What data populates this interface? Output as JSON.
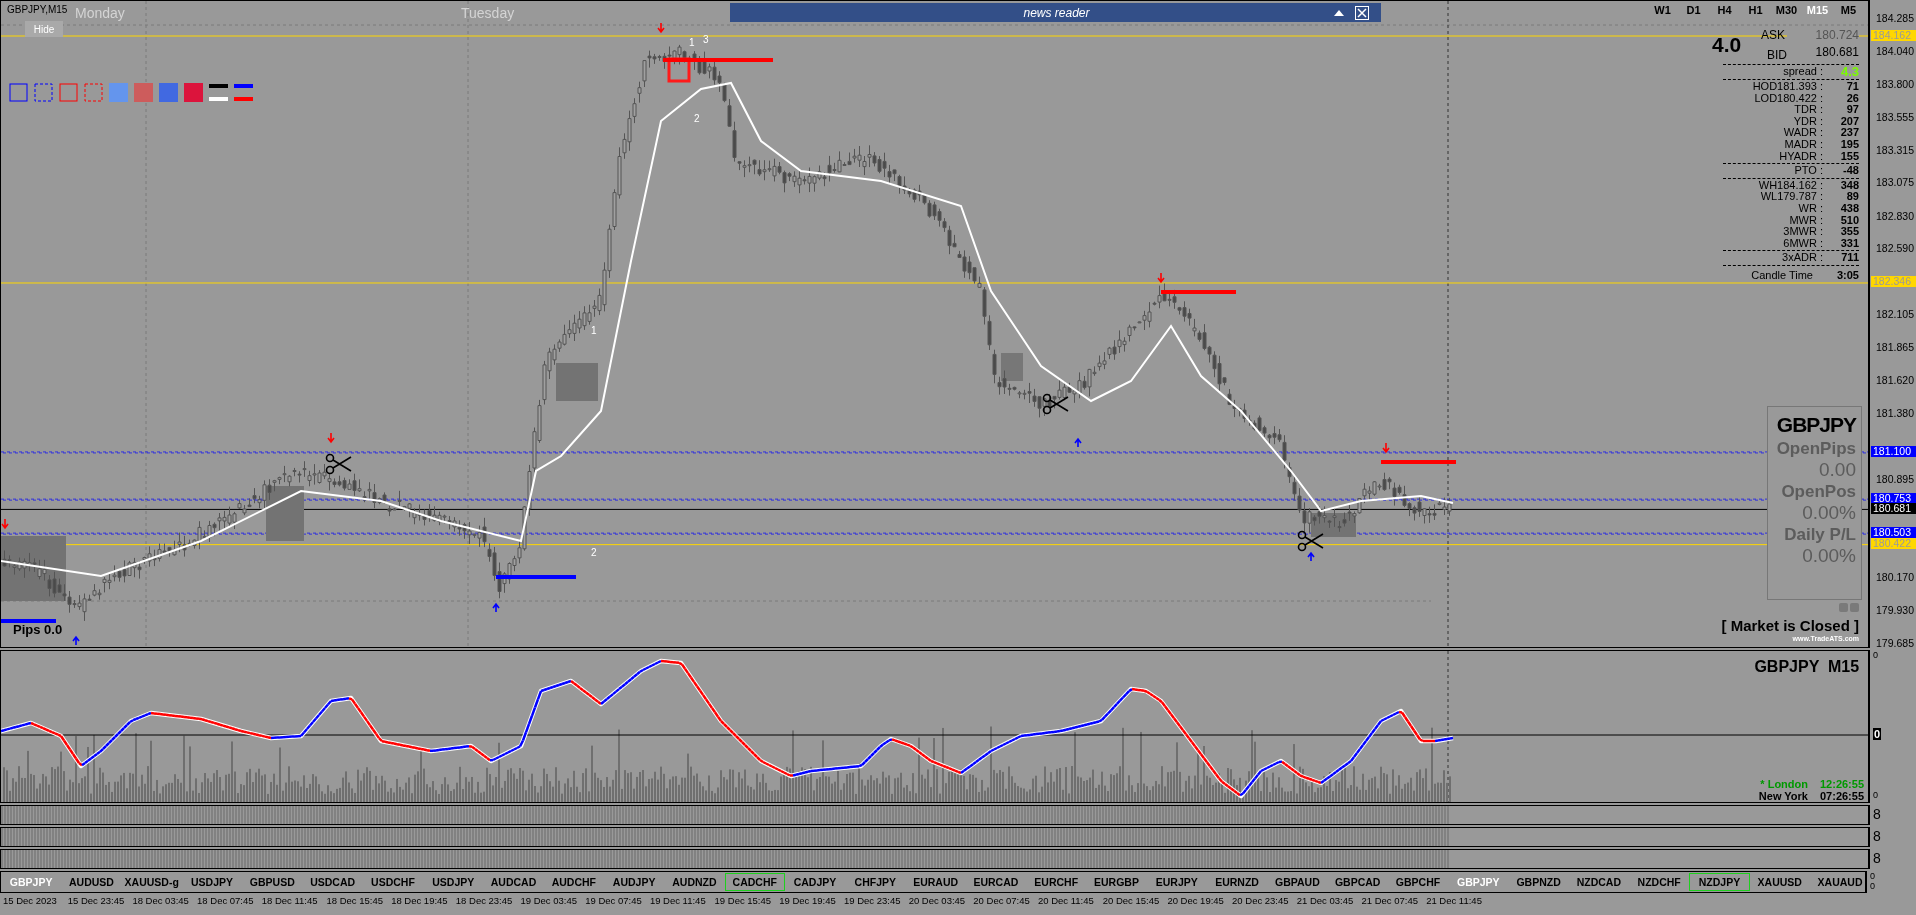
{
  "chart": {
    "title": "GBPJPY,M15",
    "hide_button": "Hide",
    "day_labels": [
      "Monday",
      "Tuesday"
    ],
    "news_reader": {
      "title": "news reader"
    },
    "wave_labels": [
      "1",
      "3",
      "2",
      "1",
      "2"
    ],
    "pips": "Pips 0.0"
  },
  "timeframes": [
    {
      "label": "W1",
      "selected": false
    },
    {
      "label": "D1",
      "selected": false
    },
    {
      "label": "H4",
      "selected": false
    },
    {
      "label": "H1",
      "selected": false
    },
    {
      "label": "M30",
      "selected": false
    },
    {
      "label": "M15",
      "selected": true
    },
    {
      "label": "M5",
      "selected": false
    }
  ],
  "quote": {
    "spread": "4.0",
    "ask_label": "ASK",
    "ask": "180.724",
    "bid_label": "BID",
    "bid": "180.681"
  },
  "stats": {
    "groups": [
      {
        "rows": [
          {
            "label": "spread :",
            "value": "4.3",
            "color": "#7cfc00"
          }
        ]
      },
      {
        "rows": [
          {
            "label": "HOD181.393 :",
            "value": "71"
          },
          {
            "label": "LOD180.422 :",
            "value": "26"
          },
          {
            "label": "TDR :",
            "value": "97"
          },
          {
            "label": "YDR :",
            "value": "207"
          },
          {
            "label": "WADR :",
            "value": "237"
          },
          {
            "label": "MADR :",
            "value": "195"
          },
          {
            "label": "HYADR :",
            "value": "155"
          }
        ]
      },
      {
        "rows": [
          {
            "label": "PTO :",
            "value": "-48"
          }
        ]
      },
      {
        "rows": [
          {
            "label": "WH184.162 :",
            "value": "348"
          },
          {
            "label": "WL179.787 :",
            "value": "89"
          },
          {
            "label": "WR :",
            "value": "438"
          },
          {
            "label": "MWR :",
            "value": "510"
          },
          {
            "label": "3MWR :",
            "value": "355"
          },
          {
            "label": "6MWR :",
            "value": "331"
          }
        ]
      },
      {
        "rows": [
          {
            "label": "3xADR :",
            "value": "711"
          }
        ]
      }
    ],
    "candle_time": {
      "label": "Candle Time",
      "value": "3:05"
    }
  },
  "price_axis": [
    {
      "label": "184.285",
      "kind": "tick"
    },
    {
      "label": "184.162",
      "kind": "level",
      "color": "#ffd700",
      "dashed": false
    },
    {
      "label": "184.040",
      "kind": "tick"
    },
    {
      "label": "183.800",
      "kind": "tick"
    },
    {
      "label": "183.555",
      "kind": "tick"
    },
    {
      "label": "183.315",
      "kind": "tick"
    },
    {
      "label": "183.075",
      "kind": "tick"
    },
    {
      "label": "182.830",
      "kind": "tick"
    },
    {
      "label": "182.590",
      "kind": "tick"
    },
    {
      "label": "182.346",
      "kind": "level",
      "color": "#ffd700",
      "dashed": false
    },
    {
      "label": "182.105",
      "kind": "tick"
    },
    {
      "label": "181.865",
      "kind": "tick"
    },
    {
      "label": "181.620",
      "kind": "tick"
    },
    {
      "label": "181.380",
      "kind": "tick"
    },
    {
      "label": "181.100",
      "kind": "level",
      "color": "#0000ff",
      "dashed": true
    },
    {
      "label": "180.895",
      "kind": "tick"
    },
    {
      "label": "180.753",
      "kind": "level",
      "color": "#0000ff",
      "dashed": true
    },
    {
      "label": "180.681",
      "kind": "level",
      "color": "#000000",
      "dashed": false
    },
    {
      "label": "180.503",
      "kind": "level",
      "color": "#0000ff",
      "dashed": true
    },
    {
      "label": "180.422",
      "kind": "level",
      "color": "#ffd700",
      "dashed": false
    },
    {
      "label": "180.170",
      "kind": "tick"
    },
    {
      "label": "179.930",
      "kind": "tick"
    },
    {
      "label": "179.685",
      "kind": "tick"
    }
  ],
  "account_panel": {
    "symbol": "GBPJPY",
    "fields": [
      {
        "label": "OpenPips",
        "value": "0.00"
      },
      {
        "label": "OpenPos",
        "value": "0.00%"
      },
      {
        "label": "Daily P/L",
        "value": "0.00%"
      }
    ]
  },
  "market_status": "[ Market is Closed ]",
  "website": "www.TradeATS.com",
  "indicator": {
    "title": "GBPJPY  M15",
    "sessions": [
      {
        "name": "* London",
        "time": "12:26:55",
        "color": "#009900"
      },
      {
        "name": "New York",
        "time": "07:26:55",
        "color": "#000000"
      }
    ],
    "axis": [
      "0",
      "0",
      "0"
    ]
  },
  "sub_panes": [
    {
      "axis": "8"
    },
    {
      "axis": "8"
    },
    {
      "axis": "8"
    }
  ],
  "symbols": [
    {
      "label": "GBPJPY",
      "selected": true,
      "outlined": false
    },
    {
      "label": "AUDUSD",
      "selected": false,
      "outlined": false
    },
    {
      "label": "XAUUSD-g",
      "selected": false,
      "outlined": false
    },
    {
      "label": "USDJPY",
      "selected": false,
      "outlined": false
    },
    {
      "label": "GBPUSD",
      "selected": false,
      "outlined": false
    },
    {
      "label": "USDCAD",
      "selected": false,
      "outlined": false
    },
    {
      "label": "USDCHF",
      "selected": false,
      "outlined": false
    },
    {
      "label": "USDJPY",
      "selected": false,
      "outlined": false
    },
    {
      "label": "AUDCAD",
      "selected": false,
      "outlined": false
    },
    {
      "label": "AUDCHF",
      "selected": false,
      "outlined": false
    },
    {
      "label": "AUDJPY",
      "selected": false,
      "outlined": false
    },
    {
      "label": "AUDNZD",
      "selected": false,
      "outlined": false
    },
    {
      "label": "CADCHF",
      "selected": false,
      "outlined": true
    },
    {
      "label": "CADJPY",
      "selected": false,
      "outlined": false
    },
    {
      "label": "CHFJPY",
      "selected": false,
      "outlined": false
    },
    {
      "label": "EURAUD",
      "selected": false,
      "outlined": false
    },
    {
      "label": "EURCAD",
      "selected": false,
      "outlined": false
    },
    {
      "label": "EURCHF",
      "selected": false,
      "outlined": false
    },
    {
      "label": "EURGBP",
      "selected": false,
      "outlined": false
    },
    {
      "label": "EURJPY",
      "selected": false,
      "outlined": false
    },
    {
      "label": "EURNZD",
      "selected": false,
      "outlined": false
    },
    {
      "label": "GBPAUD",
      "selected": false,
      "outlined": false
    },
    {
      "label": "GBPCAD",
      "selected": false,
      "outlined": false
    },
    {
      "label": "GBPCHF",
      "selected": false,
      "outlined": false
    },
    {
      "label": "GBPJPY",
      "selected": true,
      "outlined": false
    },
    {
      "label": "GBPNZD",
      "selected": false,
      "outlined": false
    },
    {
      "label": "NZDCAD",
      "selected": false,
      "outlined": false
    },
    {
      "label": "NZDCHF",
      "selected": false,
      "outlined": false
    },
    {
      "label": "NZDJPY",
      "selected": false,
      "outlined": true
    },
    {
      "label": "XAUUSD",
      "selected": false,
      "outlined": false
    },
    {
      "label": "XAUAUD",
      "selected": false,
      "outlined": false
    }
  ],
  "symbols_axis": [
    "0",
    "0"
  ],
  "time_axis": [
    "15 Dec 2023",
    "15 Dec 23:45",
    "18 Dec 03:45",
    "18 Dec 07:45",
    "18 Dec 11:45",
    "18 Dec 15:45",
    "18 Dec 19:45",
    "18 Dec 23:45",
    "19 Dec 03:45",
    "19 Dec 07:45",
    "19 Dec 11:45",
    "19 Dec 15:45",
    "19 Dec 19:45",
    "19 Dec 23:45",
    "20 Dec 03:45",
    "20 Dec 07:45",
    "20 Dec 11:45",
    "20 Dec 15:45",
    "20 Dec 19:45",
    "20 Dec 23:45",
    "21 Dec 03:45",
    "21 Dec 07:45",
    "21 Dec 11:45"
  ]
}
